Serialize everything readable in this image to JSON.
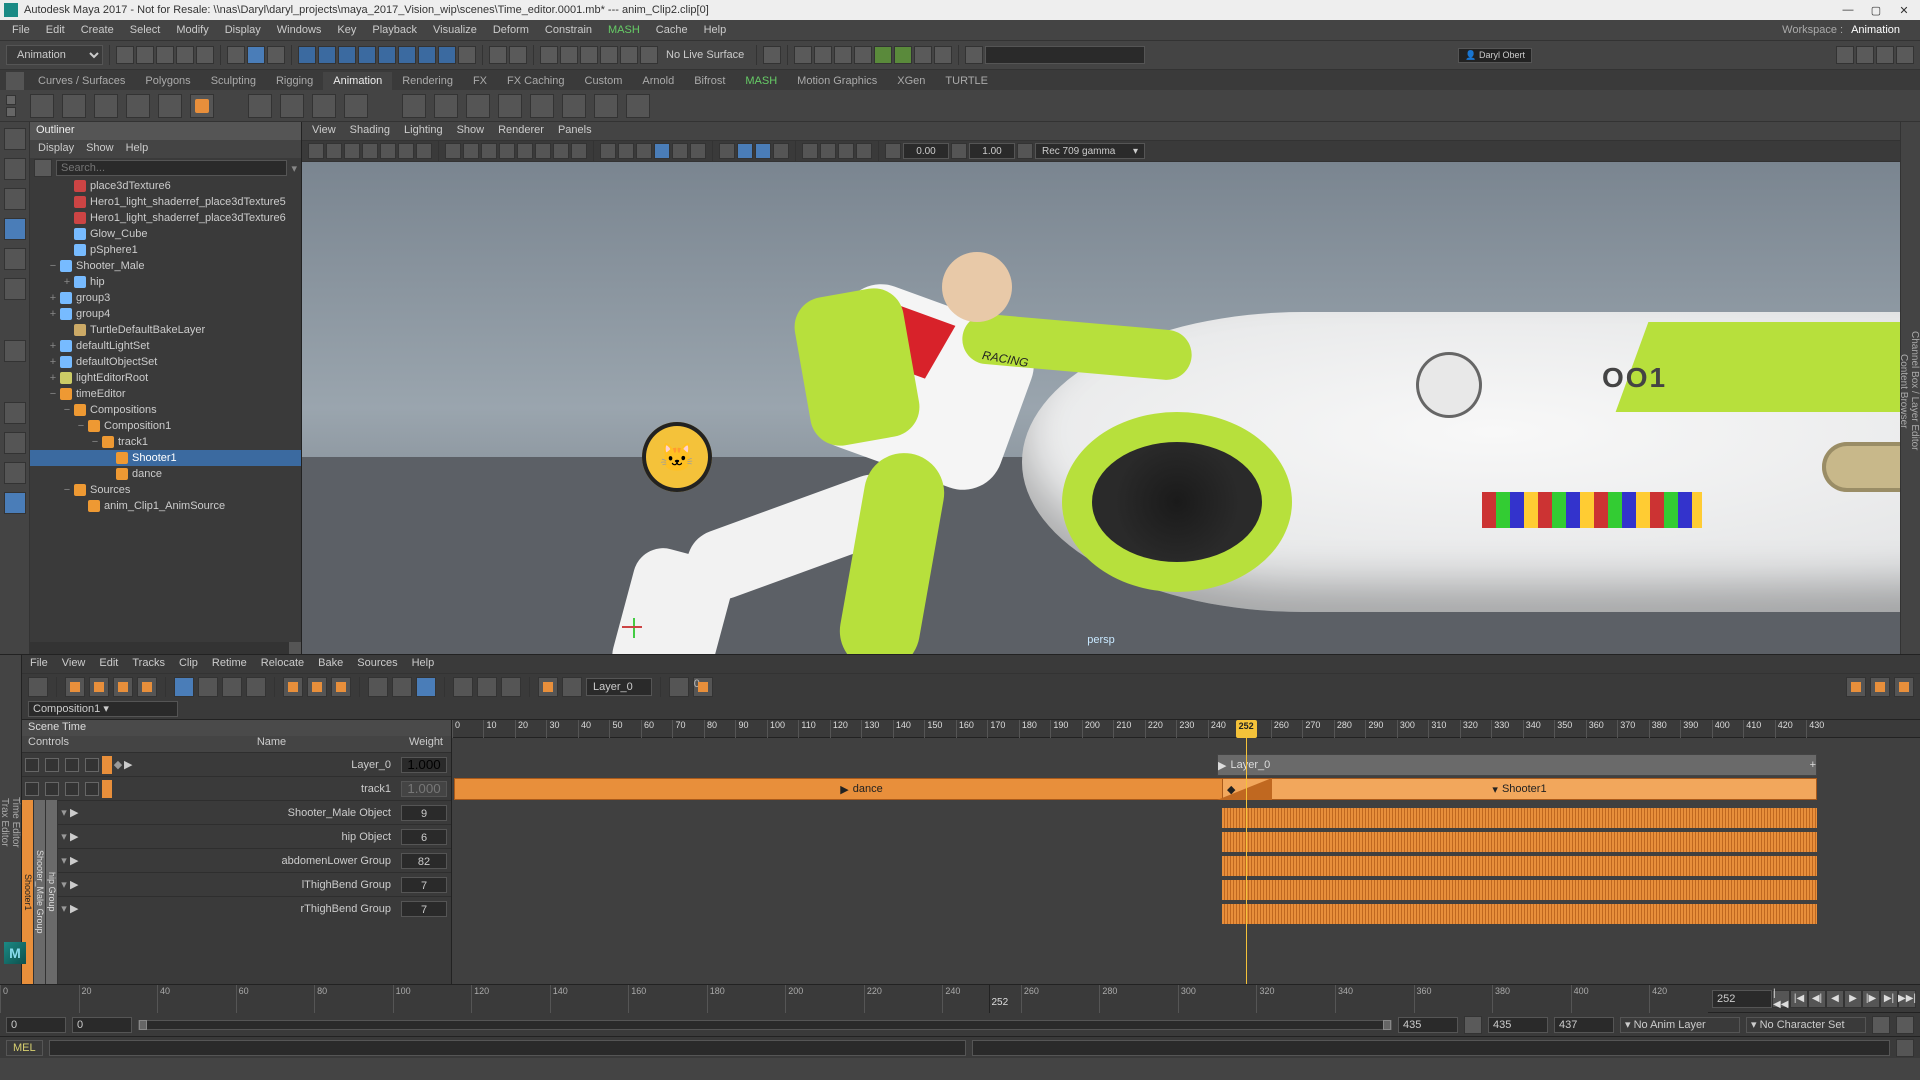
{
  "window": {
    "title": "Autodesk Maya 2017 - Not for Resale: \\\\nas\\Daryl\\daryl_projects\\maya_2017_Vision_wip\\scenes\\Time_editor.0001.mb*   ---   anim_Clip2.clip[0]",
    "controls": {
      "min": "—",
      "max": "▢",
      "close": "✕"
    }
  },
  "menubar": {
    "items": [
      "File",
      "Edit",
      "Create",
      "Select",
      "Modify",
      "Display",
      "Windows",
      "Key",
      "Playback",
      "Visualize",
      "Deform",
      "Constrain",
      "MASH",
      "Cache",
      "Help"
    ],
    "workspace_label": "Workspace :",
    "workspace_value": "Animation"
  },
  "modulesel": "Animation",
  "nls": "No Live Surface",
  "userbadge": "Daryl Obert",
  "shelf_tabs": [
    "Curves / Surfaces",
    "Polygons",
    "Sculpting",
    "Rigging",
    "Animation",
    "Rendering",
    "FX",
    "FX Caching",
    "Custom",
    "Arnold",
    "Bifrost",
    "MASH",
    "Motion Graphics",
    "XGen",
    "TURTLE"
  ],
  "shelf_active": "Animation",
  "outliner": {
    "title": "Outliner",
    "menu": [
      "Display",
      "Show",
      "Help"
    ],
    "search_ph": "Search...",
    "items": [
      {
        "ind": 2,
        "c": "#c44",
        "t": "place3dTexture6"
      },
      {
        "ind": 2,
        "c": "#c44",
        "t": "Hero1_light_shaderref_place3dTexture5"
      },
      {
        "ind": 2,
        "c": "#c44",
        "t": "Hero1_light_shaderref_place3dTexture6"
      },
      {
        "ind": 2,
        "c": "#7bf",
        "t": "Glow_Cube"
      },
      {
        "ind": 2,
        "c": "#7bf",
        "t": "pSphere1"
      },
      {
        "ind": 1,
        "exp": "−",
        "c": "#7bf",
        "t": "Shooter_Male"
      },
      {
        "ind": 2,
        "exp": "+",
        "c": "#7bf",
        "t": "hip"
      },
      {
        "ind": 1,
        "exp": "+",
        "c": "#7bf",
        "t": "group3"
      },
      {
        "ind": 1,
        "exp": "+",
        "c": "#7bf",
        "t": "group4"
      },
      {
        "ind": 2,
        "c": "#ca6",
        "t": "TurtleDefaultBakeLayer"
      },
      {
        "ind": 1,
        "exp": "+",
        "c": "#7bf",
        "t": "defaultLightSet"
      },
      {
        "ind": 1,
        "exp": "+",
        "c": "#7bf",
        "t": "defaultObjectSet"
      },
      {
        "ind": 1,
        "exp": "+",
        "c": "#cc6",
        "t": "lightEditorRoot"
      },
      {
        "ind": 1,
        "exp": "−",
        "c": "#e93",
        "t": "timeEditor"
      },
      {
        "ind": 2,
        "exp": "−",
        "c": "#e93",
        "t": "Compositions"
      },
      {
        "ind": 3,
        "exp": "−",
        "c": "#e93",
        "t": "Composition1"
      },
      {
        "ind": 4,
        "exp": "−",
        "c": "#e93",
        "t": "track1"
      },
      {
        "ind": 5,
        "c": "#e93",
        "t": "Shooter1",
        "sel": true
      },
      {
        "ind": 5,
        "c": "#e93",
        "t": "dance"
      },
      {
        "ind": 2,
        "exp": "−",
        "c": "#e93",
        "t": "Sources"
      },
      {
        "ind": 3,
        "c": "#e93",
        "t": "anim_Clip1_AnimSource"
      }
    ]
  },
  "viewport": {
    "menu": [
      "View",
      "Shading",
      "Lighting",
      "Show",
      "Renderer",
      "Panels"
    ],
    "val1": "0.00",
    "val2": "1.00",
    "colorspace": "Rec 709 gamma",
    "cam": "persp",
    "ship_label": "OO1",
    "racing": "RACING"
  },
  "right_strip": [
    "Channel Box / Layer Editor",
    "Content Browser"
  ],
  "time_editor": {
    "label": "Time Editor",
    "trax_label": "Trax Editor",
    "menu": [
      "File",
      "View",
      "Edit",
      "Tracks",
      "Clip",
      "Retime",
      "Relocate",
      "Bake",
      "Sources",
      "Help"
    ],
    "layer_dd": "Layer_0",
    "comp": "Composition1",
    "tree_hdr": {
      "scene": "Scene Time",
      "controls": "Controls",
      "name": "Name",
      "weight": "Weight"
    },
    "rows_top": [
      {
        "name": "Layer_0",
        "w": "1.000"
      },
      {
        "name": "track1",
        "w": "1.000",
        "dim": true
      }
    ],
    "vert1": "Shooter1",
    "vert2": "Shooter_Male Group",
    "vert3": "hip Group",
    "rows_grp": [
      {
        "name": "Shooter_Male Object",
        "w": "9"
      },
      {
        "name": "hip Object",
        "w": "6"
      },
      {
        "name": "abdomenLower Group",
        "w": "82"
      },
      {
        "name": "lThighBend Group",
        "w": "7"
      },
      {
        "name": "rThighBend Group",
        "w": "7"
      }
    ],
    "ruler": {
      "start": 0,
      "end": 435,
      "step": 10,
      "current": 252
    },
    "clips": {
      "dance": "dance",
      "layer0": "Layer_0",
      "shooter1": "Shooter1"
    }
  },
  "bottom": {
    "ruler": {
      "start": 0,
      "end": 435,
      "step": 20,
      "current": 252
    },
    "frame": "252",
    "range": {
      "in1": "0",
      "in2": "0",
      "out1": "435",
      "out2": "435",
      "third": "437"
    },
    "anim_layer": "No Anim Layer",
    "char_set": "No Character Set"
  },
  "cmd": {
    "lang": "MEL"
  }
}
